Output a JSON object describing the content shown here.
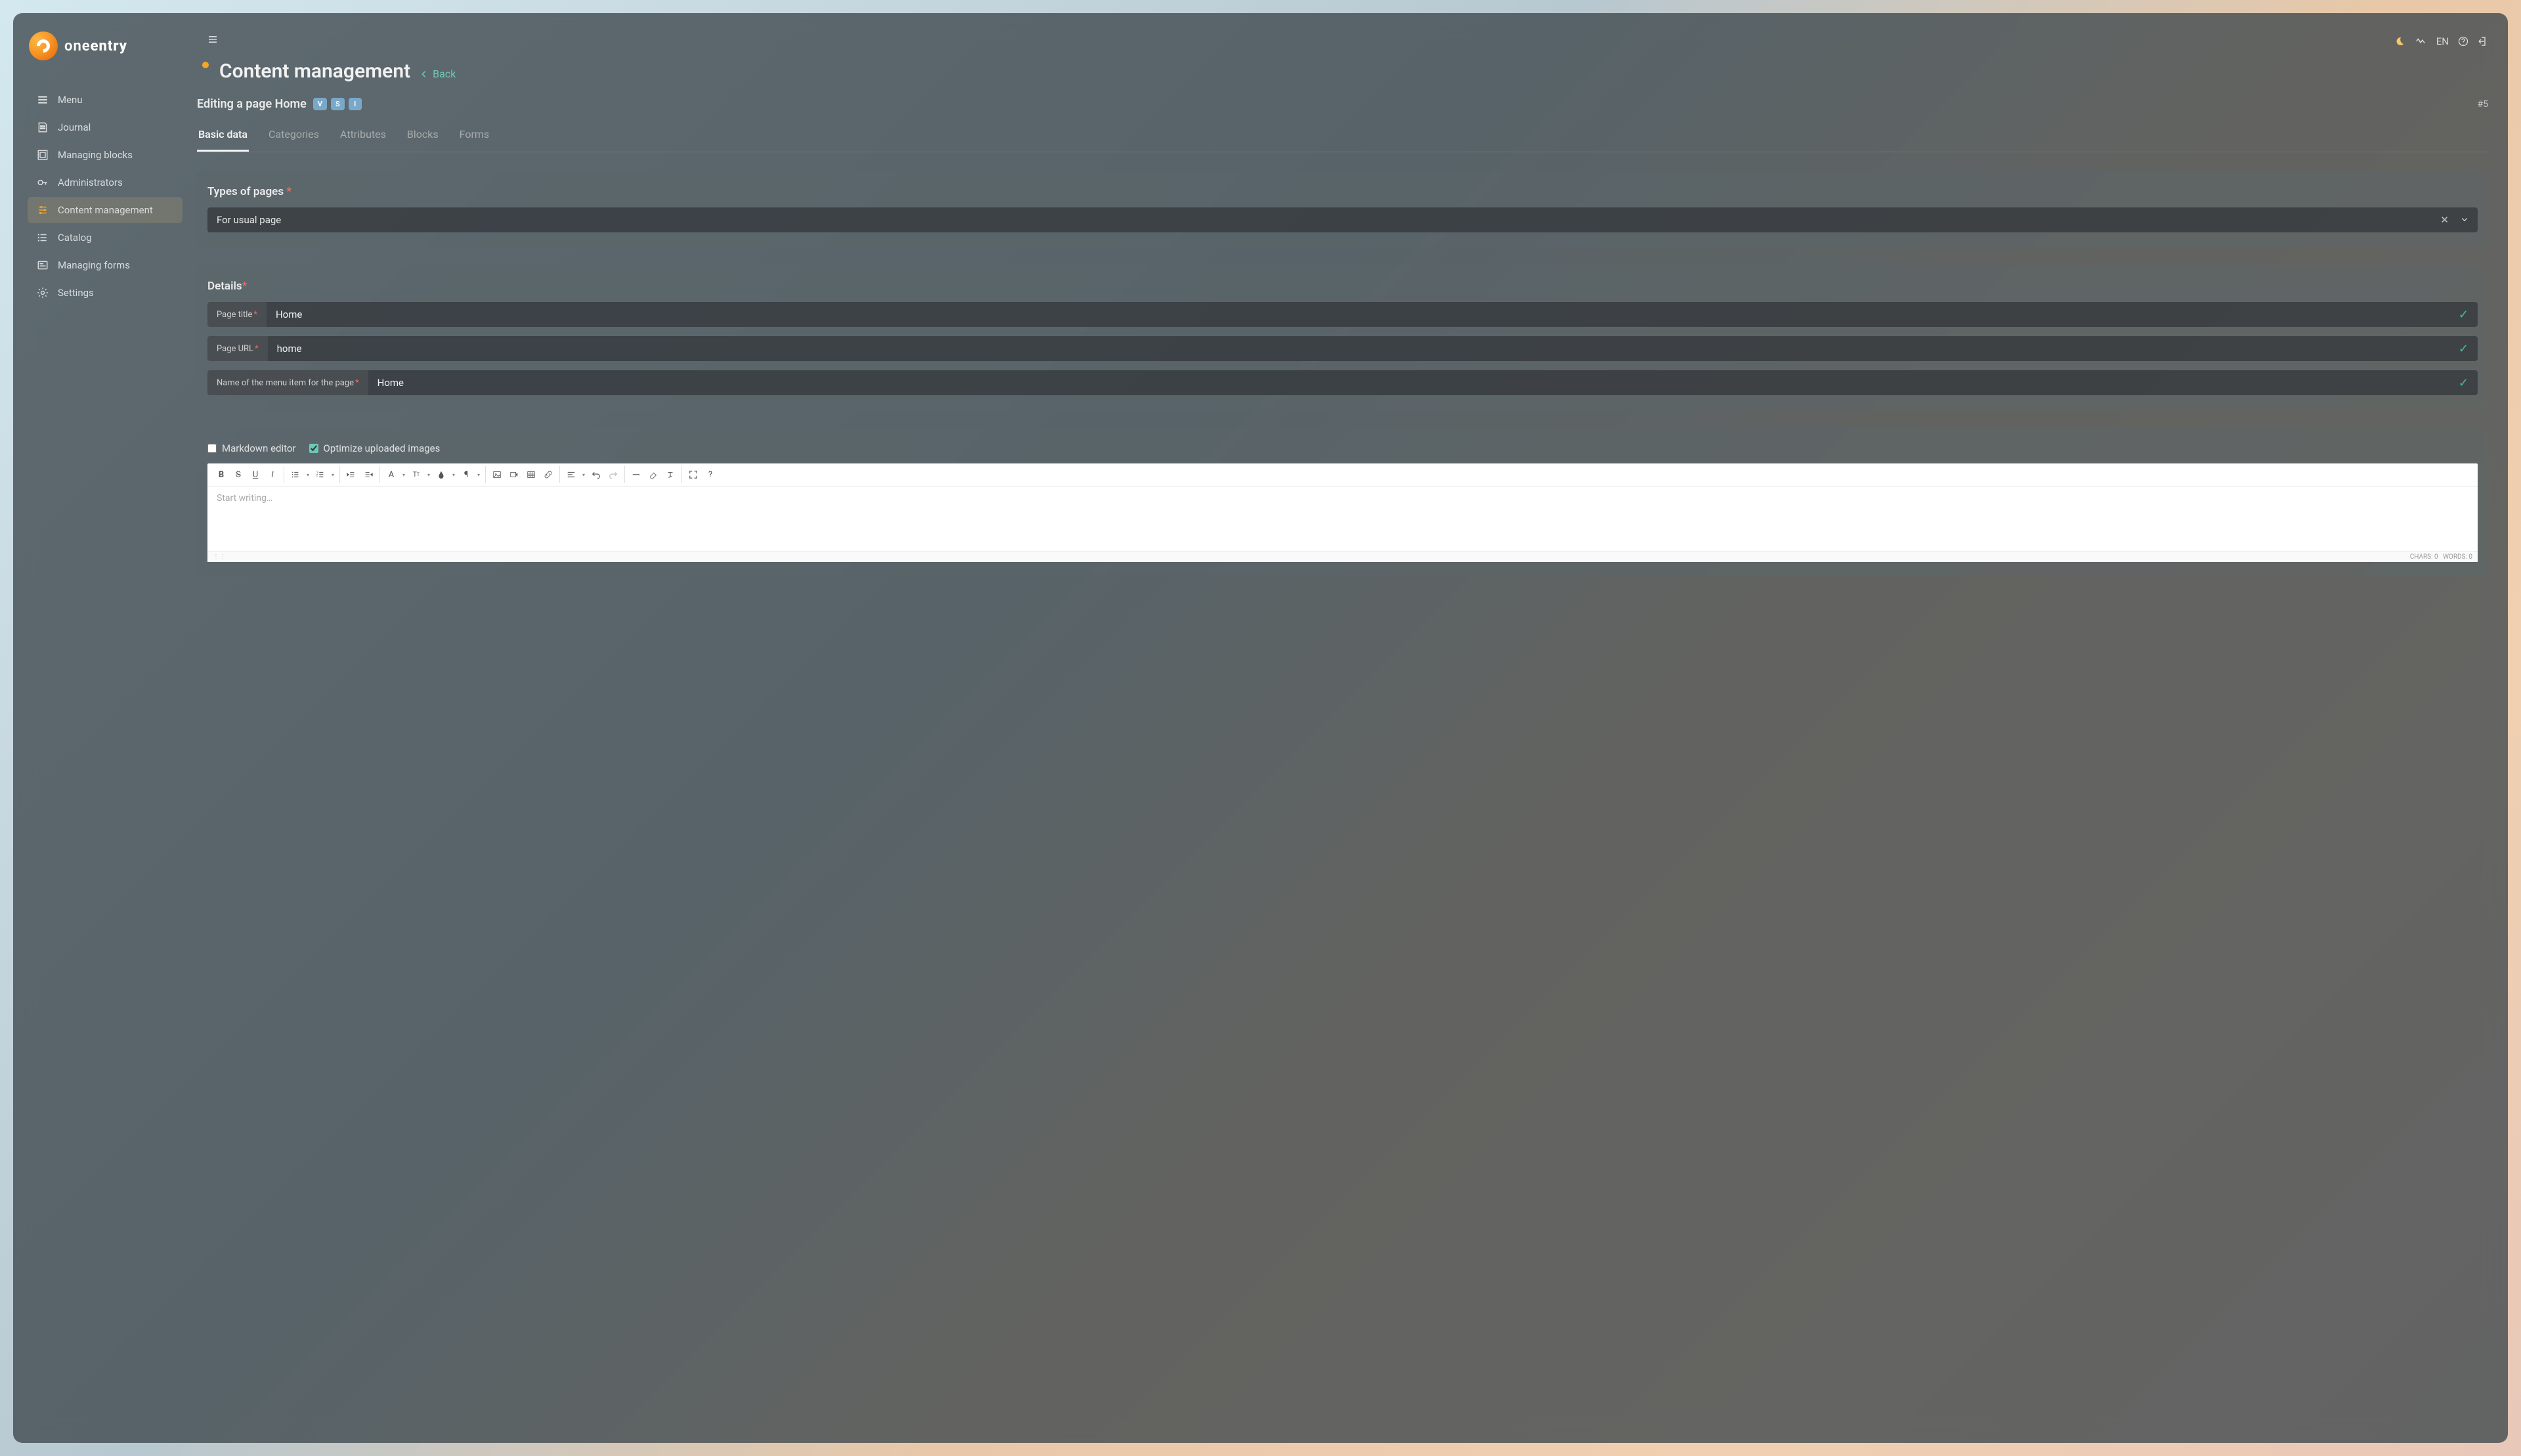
{
  "brand": {
    "name_a": "one",
    "name_b": "entry"
  },
  "sidebar": {
    "items": [
      {
        "label": "Menu",
        "icon": "menu"
      },
      {
        "label": "Journal",
        "icon": "journal"
      },
      {
        "label": "Managing blocks",
        "icon": "blocks"
      },
      {
        "label": "Administrators",
        "icon": "key"
      },
      {
        "label": "Content management",
        "icon": "sliders",
        "active": true
      },
      {
        "label": "Catalog",
        "icon": "list"
      },
      {
        "label": "Managing forms",
        "icon": "form"
      },
      {
        "label": "Settings",
        "icon": "gear"
      }
    ]
  },
  "topbar": {
    "lang": "EN"
  },
  "header": {
    "title": "Content management",
    "back": "Back"
  },
  "subheader": {
    "title": "Editing a page Home",
    "badges": [
      "V",
      "S",
      "I"
    ],
    "hash": "#5"
  },
  "tabs": [
    "Basic data",
    "Categories",
    "Attributes",
    "Blocks",
    "Forms"
  ],
  "active_tab": 0,
  "types_panel": {
    "label": "Types of pages",
    "value": "For usual page"
  },
  "details_panel": {
    "label": "Details",
    "fields": {
      "page_title": {
        "label": "Page title",
        "value": "Home"
      },
      "page_url": {
        "label": "Page URL",
        "value": "home"
      },
      "menu_name": {
        "label": "Name of the menu item for the page",
        "value": "Home"
      }
    }
  },
  "editor_panel": {
    "markdown_label": "Markdown editor",
    "markdown_checked": false,
    "optimize_label": "Optimize uploaded images",
    "optimize_checked": true,
    "placeholder": "Start writing…",
    "chars": "CHARS: 0",
    "words": "WORDS: 0"
  }
}
